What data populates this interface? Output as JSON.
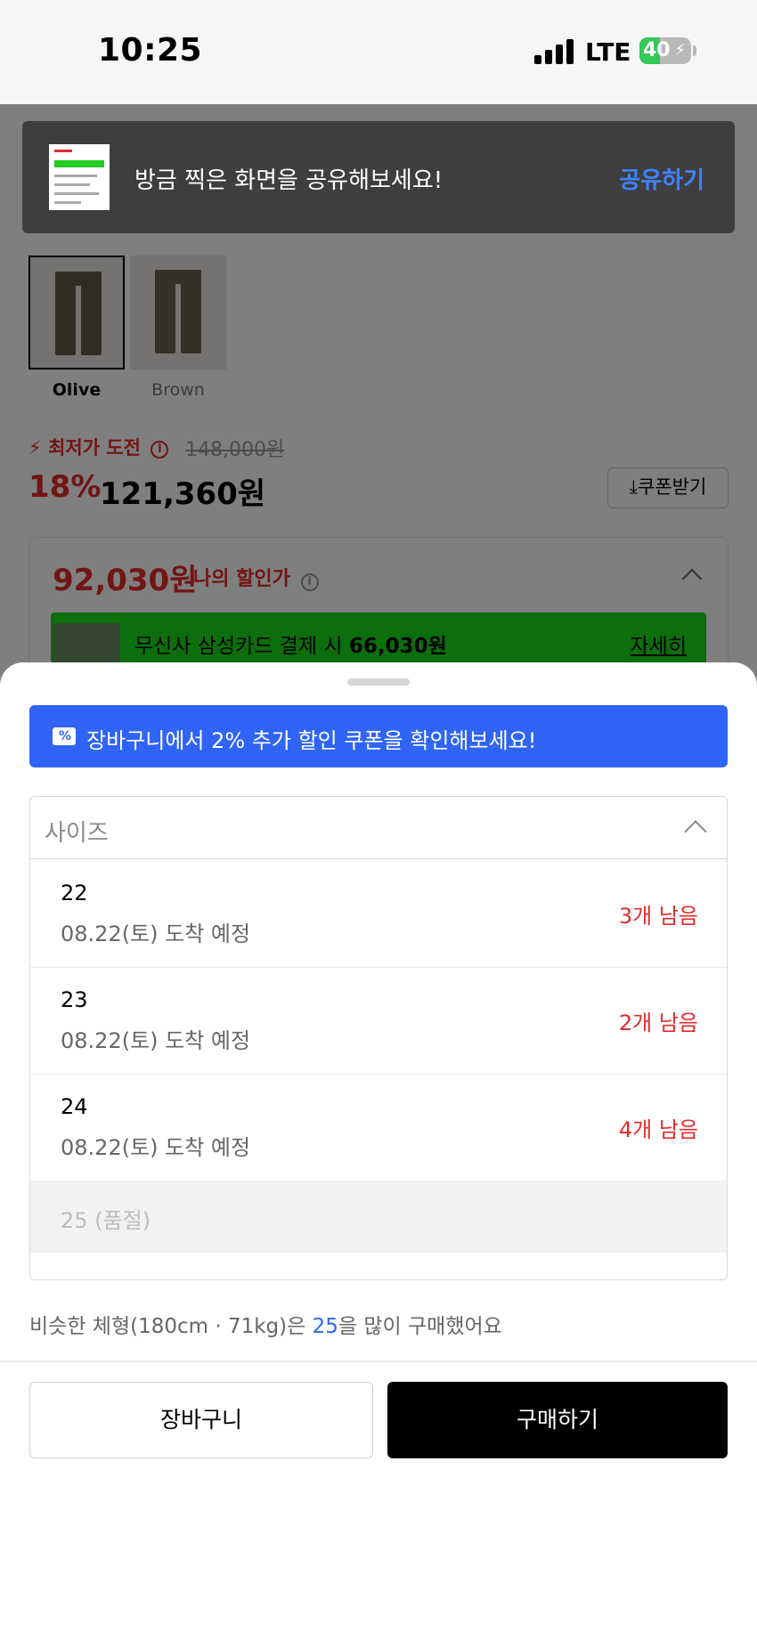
{
  "status_bar": {
    "time": "10:25",
    "network": "LTE",
    "battery": "40",
    "battery_level": 0.4
  },
  "toast": {
    "message": "방금 찍은 화면을 공유해보세요!",
    "share_label": "공유하기"
  },
  "product": {
    "colors": [
      {
        "label": "Olive",
        "selected": true
      },
      {
        "label": "Brown",
        "selected": false
      }
    ],
    "lowest_price_label": "최저가 도전",
    "original_price": "148,000원",
    "discount_rate": "18%",
    "price": "121,360원",
    "coupon_button": "쿠폰받기",
    "my_price": "92,030원",
    "my_price_label": "나의 할인가",
    "card_banner": {
      "text_prefix": "무신사 삼성카드 결제 시 ",
      "amount": "66,030원",
      "more": "자세히"
    }
  },
  "sheet": {
    "promo": "장바구니에서 2% 추가 할인 쿠폰을 확인해보세요!",
    "size_placeholder": "사이즈",
    "options": [
      {
        "size": "22",
        "arrival": "08.22(토) 도착 예정",
        "stock": "3개 남음"
      },
      {
        "size": "23",
        "arrival": "08.22(토) 도착 예정",
        "stock": "2개 남음"
      },
      {
        "size": "24",
        "arrival": "08.22(토) 도착 예정",
        "stock": "4개 남음"
      }
    ],
    "soldout_option": "25 (품절)",
    "similar_prefix": "비슷한 체형(180cm · 71kg)은 ",
    "similar_size": "25",
    "similar_suffix": "을 많이 구매했어요",
    "cart_button": "장바구니",
    "buy_button": "구매하기"
  }
}
